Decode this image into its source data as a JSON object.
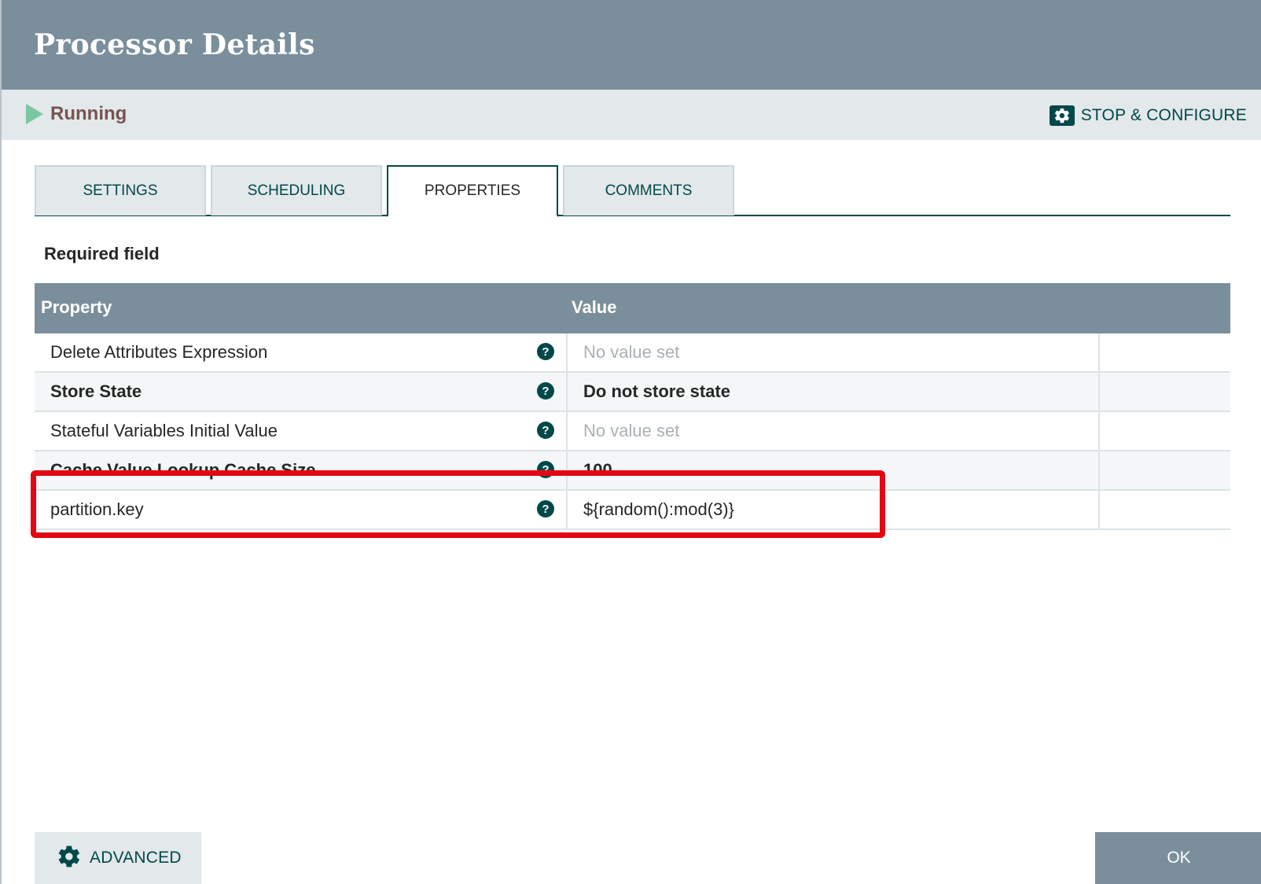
{
  "header": {
    "title": "Processor Details"
  },
  "status": {
    "state_label": "Running",
    "stop_configure_label": "STOP & CONFIGURE"
  },
  "tabs": [
    {
      "label": "SETTINGS"
    },
    {
      "label": "SCHEDULING"
    },
    {
      "label": "PROPERTIES"
    },
    {
      "label": "COMMENTS"
    }
  ],
  "active_tab": "PROPERTIES",
  "required_label": "Required field",
  "table": {
    "headers": {
      "property": "Property",
      "value": "Value"
    },
    "rows": [
      {
        "name": "Delete Attributes Expression",
        "value": "No value set",
        "required": false,
        "empty": true
      },
      {
        "name": "Store State",
        "value": "Do not store state",
        "required": true,
        "empty": false
      },
      {
        "name": "Stateful Variables Initial Value",
        "value": "No value set",
        "required": false,
        "empty": true
      },
      {
        "name": "Cache Value Lookup Cache Size",
        "value": "100",
        "required": true,
        "empty": false
      },
      {
        "name": "partition.key",
        "value": "${random():mod(3)}",
        "required": false,
        "empty": false
      }
    ]
  },
  "footer": {
    "advanced_label": "ADVANCED",
    "ok_label": "OK"
  },
  "colors": {
    "header_bg": "#7a8f9b",
    "accent": "#004849",
    "highlight": "#e30613",
    "running": "#7dc7a0"
  }
}
